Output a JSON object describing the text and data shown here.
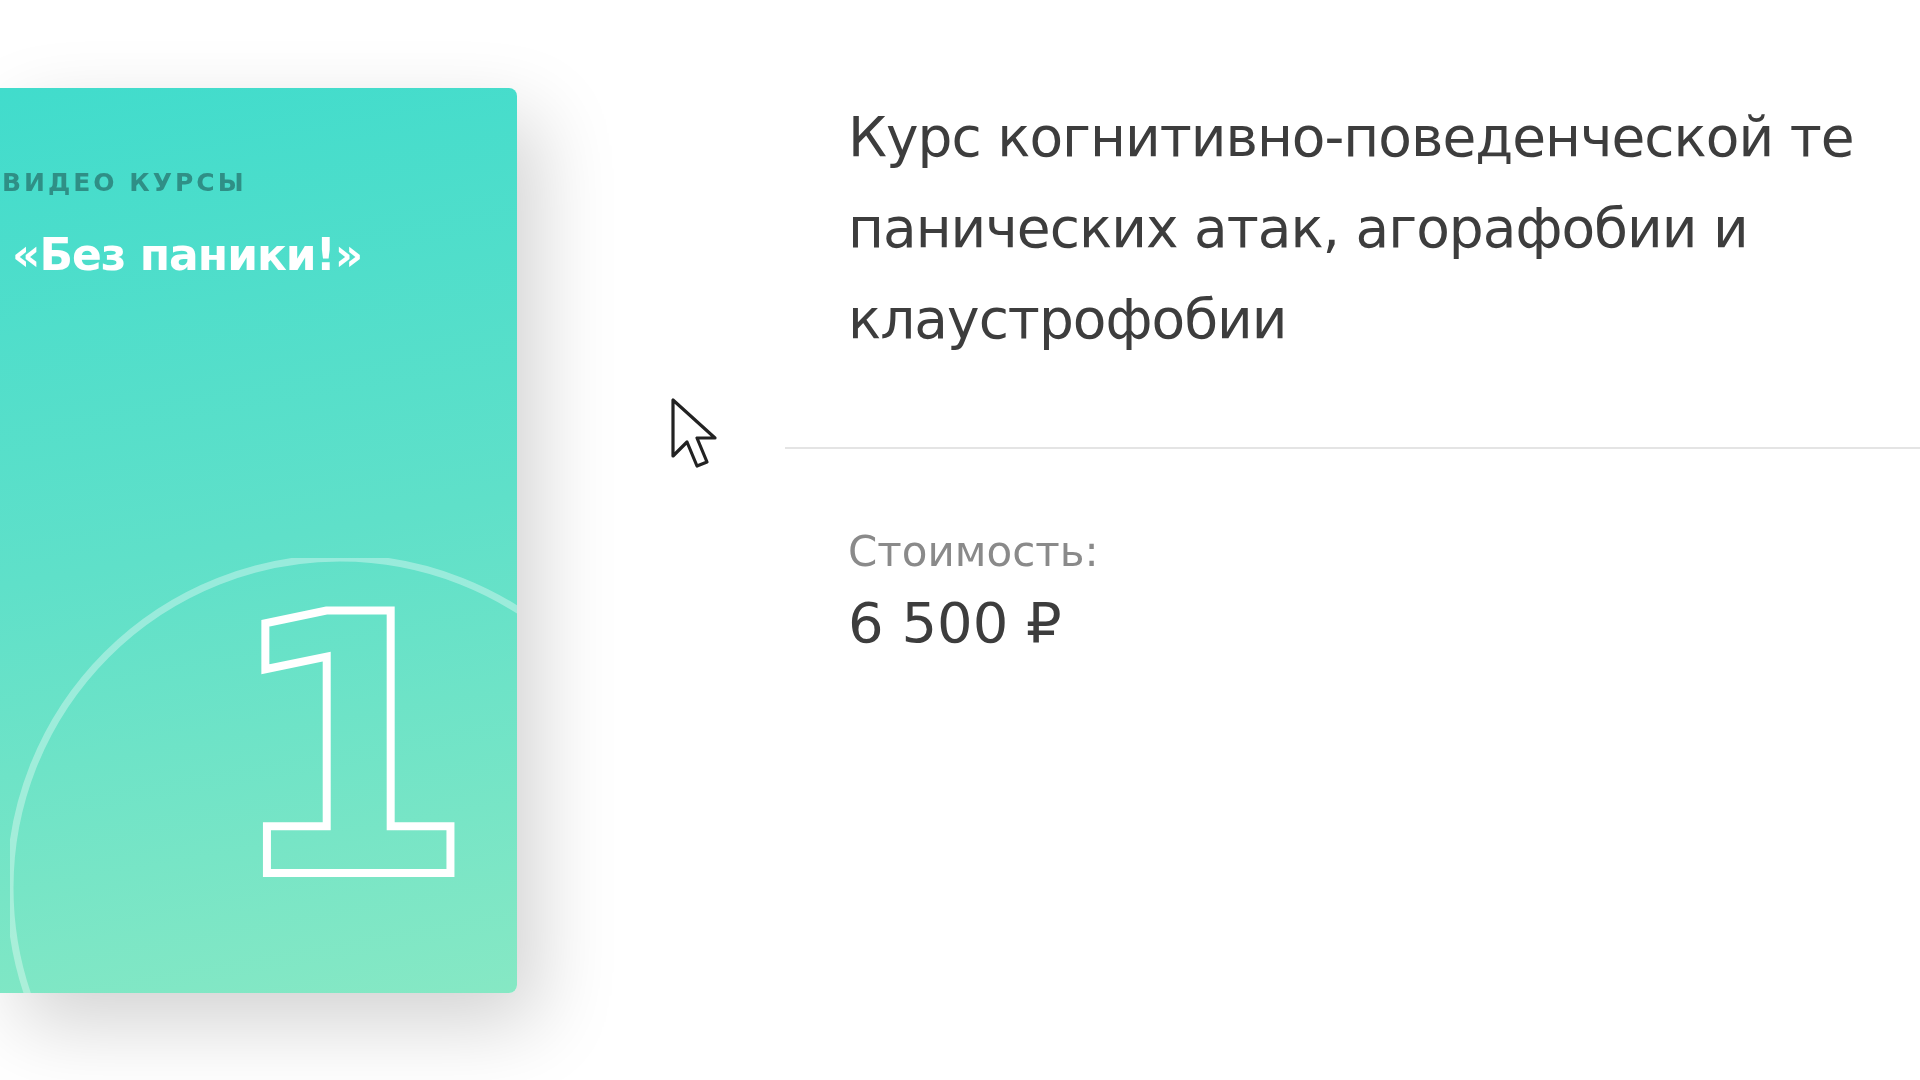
{
  "course_card": {
    "category": "ВИДЕО КУРСЫ",
    "title": "«Без паники!»",
    "number": "1"
  },
  "course": {
    "title_lines": [
      "Курс когнитивно-поведенческой те",
      "панических атак, агорафобии и",
      "клаустрофобии"
    ],
    "price_label": "Стоимость:",
    "price": "6 500 ₽"
  }
}
